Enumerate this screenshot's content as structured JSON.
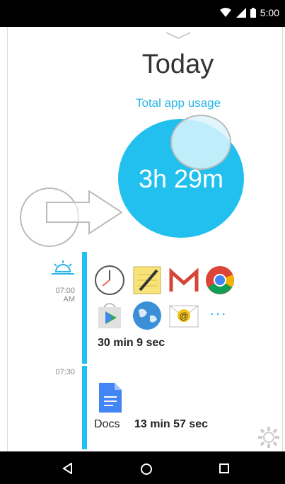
{
  "status_bar": {
    "time": "5:00"
  },
  "header": {
    "title": "Today",
    "subtitle": "Total app usage"
  },
  "summary": {
    "total_usage": "3h 29m"
  },
  "timeline": {
    "slots": [
      {
        "time_label": [
          "07:00",
          "AM"
        ],
        "apps": [
          "clock-app",
          "notes-app",
          "gmail-app",
          "chrome-app",
          "play-store-app",
          "earth-app",
          "mail-app"
        ],
        "more": "···",
        "duration": "30 min 9 sec"
      },
      {
        "time_label": [
          "07:30"
        ],
        "app_name": "Docs",
        "duration": "13 min 57 sec"
      }
    ]
  },
  "colors": {
    "accent": "#22c0ee",
    "bar": "#000000"
  }
}
